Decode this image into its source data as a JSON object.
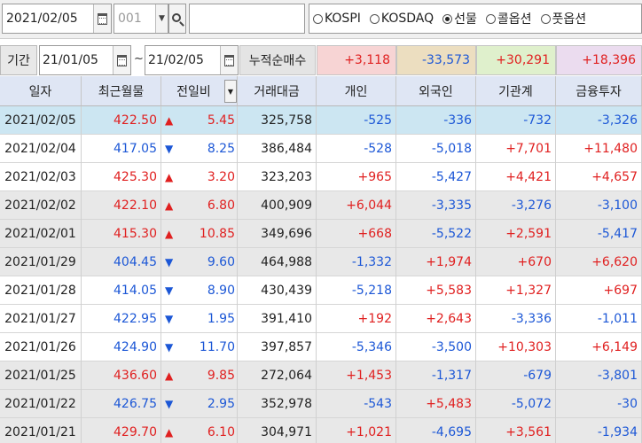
{
  "toolbar": {
    "date": "2021/02/05",
    "code": "001",
    "code_dropdown_glyph": "▼",
    "name": "",
    "markets": [
      {
        "label": "KOSPI",
        "selected": false
      },
      {
        "label": "KOSDAQ",
        "selected": false
      },
      {
        "label": "선물",
        "selected": true
      },
      {
        "label": "콜옵션",
        "selected": false
      },
      {
        "label": "풋옵션",
        "selected": false
      }
    ]
  },
  "period": {
    "label": "기간",
    "start": "21/01/05",
    "separator": "~",
    "end": "21/02/05",
    "sum_label": "누적순매수",
    "sums": [
      {
        "value": "+3,118",
        "color": "#f7d4d4",
        "text_color": "#e02020"
      },
      {
        "value": "-33,573",
        "color": "#ecdec0",
        "text_color": "#1c57d6"
      },
      {
        "value": "+30,291",
        "color": "#dff0cc",
        "text_color": "#e02020"
      },
      {
        "value": "+18,396",
        "color": "#ebdcef",
        "text_color": "#e02020"
      }
    ]
  },
  "table": {
    "headers": [
      "일자",
      "최근월물",
      "전일비",
      "거래대금",
      "개인",
      "외국인",
      "기관계",
      "금융투자"
    ],
    "sort_glyph": "▼",
    "rows": [
      {
        "date": "2021/02/05",
        "price": "422.50",
        "dir": "up",
        "chg": "5.45",
        "amount": "325,758",
        "indiv": "-525",
        "foreign": "-336",
        "inst": "-732",
        "fin": "-3,326",
        "style": "sel"
      },
      {
        "date": "2021/02/04",
        "price": "417.05",
        "dir": "dn",
        "chg": "8.25",
        "amount": "386,484",
        "indiv": "-528",
        "foreign": "-5,018",
        "inst": "+7,701",
        "fin": "+11,480",
        "style": "white"
      },
      {
        "date": "2021/02/03",
        "price": "425.30",
        "dir": "up",
        "chg": "3.20",
        "amount": "323,203",
        "indiv": "+965",
        "foreign": "-5,427",
        "inst": "+4,421",
        "fin": "+4,657",
        "style": "white"
      },
      {
        "date": "2021/02/02",
        "price": "422.10",
        "dir": "up",
        "chg": "6.80",
        "amount": "400,909",
        "indiv": "+6,044",
        "foreign": "-3,335",
        "inst": "-3,276",
        "fin": "-3,100",
        "style": "gray"
      },
      {
        "date": "2021/02/01",
        "price": "415.30",
        "dir": "up",
        "chg": "10.85",
        "amount": "349,696",
        "indiv": "+668",
        "foreign": "-5,522",
        "inst": "+2,591",
        "fin": "-5,417",
        "style": "gray"
      },
      {
        "date": "2021/01/29",
        "price": "404.45",
        "dir": "dn",
        "chg": "9.60",
        "amount": "464,988",
        "indiv": "-1,332",
        "foreign": "+1,974",
        "inst": "+670",
        "fin": "+6,620",
        "style": "gray"
      },
      {
        "date": "2021/01/28",
        "price": "414.05",
        "dir": "dn",
        "chg": "8.90",
        "amount": "430,439",
        "indiv": "-5,218",
        "foreign": "+5,583",
        "inst": "+1,327",
        "fin": "+697",
        "style": "white"
      },
      {
        "date": "2021/01/27",
        "price": "422.95",
        "dir": "dn",
        "chg": "1.95",
        "amount": "391,410",
        "indiv": "+192",
        "foreign": "+2,643",
        "inst": "-3,336",
        "fin": "-1,011",
        "style": "white"
      },
      {
        "date": "2021/01/26",
        "price": "424.90",
        "dir": "dn",
        "chg": "11.70",
        "amount": "397,857",
        "indiv": "-5,346",
        "foreign": "-3,500",
        "inst": "+10,303",
        "fin": "+6,149",
        "style": "white"
      },
      {
        "date": "2021/01/25",
        "price": "436.60",
        "dir": "up",
        "chg": "9.85",
        "amount": "272,064",
        "indiv": "+1,453",
        "foreign": "-1,317",
        "inst": "-679",
        "fin": "-3,801",
        "style": "gray"
      },
      {
        "date": "2021/01/22",
        "price": "426.75",
        "dir": "dn",
        "chg": "2.95",
        "amount": "352,978",
        "indiv": "-543",
        "foreign": "+5,483",
        "inst": "-5,072",
        "fin": "-30",
        "style": "gray"
      },
      {
        "date": "2021/01/21",
        "price": "429.70",
        "dir": "up",
        "chg": "6.10",
        "amount": "304,971",
        "indiv": "+1,021",
        "foreign": "-4,695",
        "inst": "+3,561",
        "fin": "-1,934",
        "style": "gray"
      }
    ]
  },
  "colors": {
    "up": "#e02020",
    "down": "#1c57d6",
    "selected_row": "#cce6f2",
    "header_bg": "#dfe6f4"
  },
  "icons": {
    "up_arrow": "▲",
    "down_arrow": "▼"
  }
}
